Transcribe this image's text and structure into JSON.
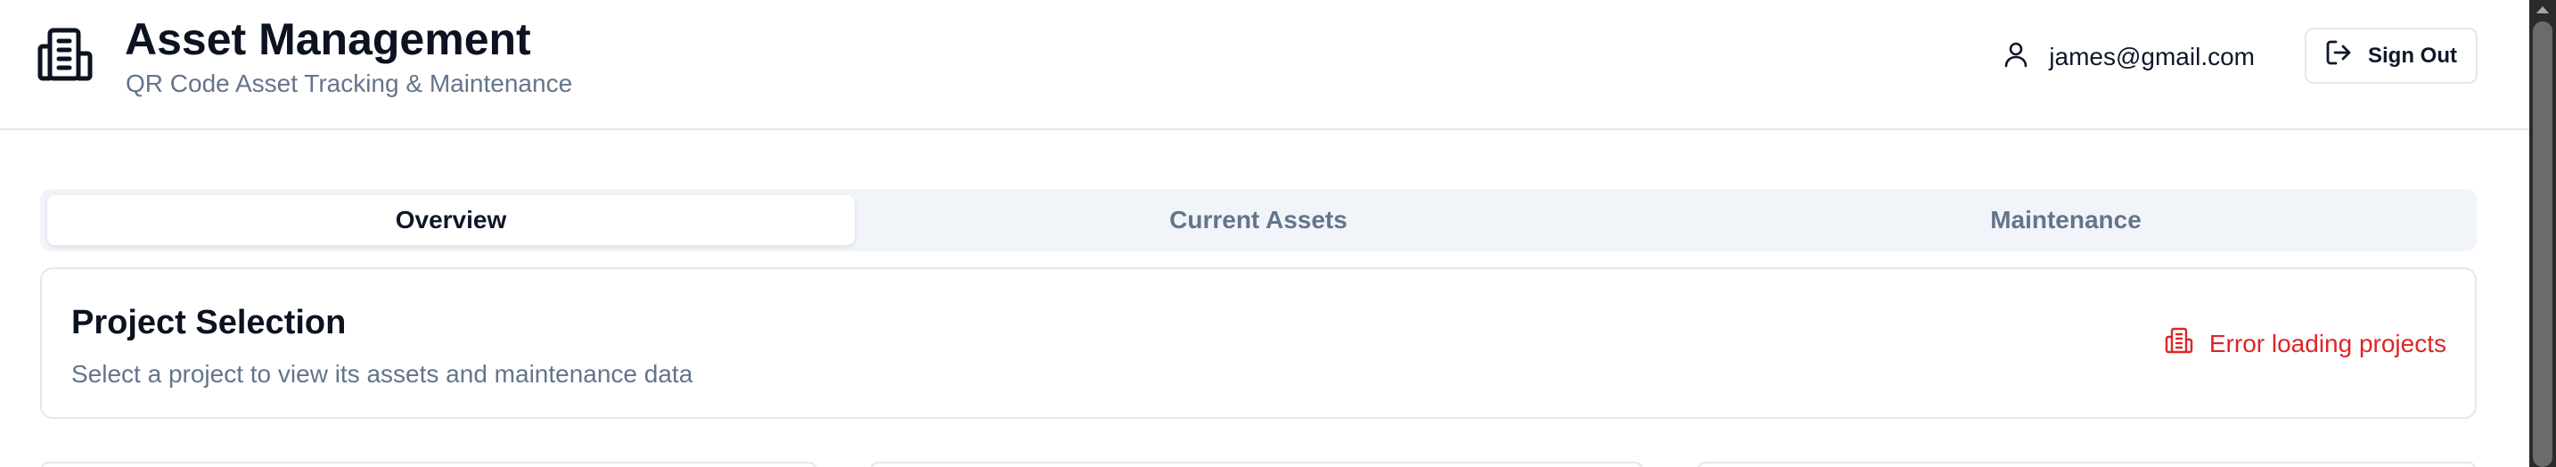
{
  "header": {
    "title": "Asset Management",
    "subtitle": "QR Code Asset Tracking & Maintenance",
    "logo_icon": "building-icon",
    "user_email": "james@gmail.com",
    "user_icon": "user-icon",
    "sign_out_label": "Sign Out",
    "sign_out_icon": "log-out-icon"
  },
  "tabs": [
    {
      "label": "Overview",
      "active": true
    },
    {
      "label": "Current Assets",
      "active": false
    },
    {
      "label": "Maintenance",
      "active": false
    }
  ],
  "project_selection": {
    "title": "Project Selection",
    "description": "Select a project to view its assets and maintenance data",
    "status_text": "Error loading projects",
    "status_icon": "building-icon",
    "status_color": "#dc2626"
  },
  "colors": {
    "text_primary": "#0f172a",
    "text_muted": "#64748b",
    "tabs_bg": "#f1f5f9",
    "border": "#e2e8f0",
    "error": "#dc2626"
  }
}
